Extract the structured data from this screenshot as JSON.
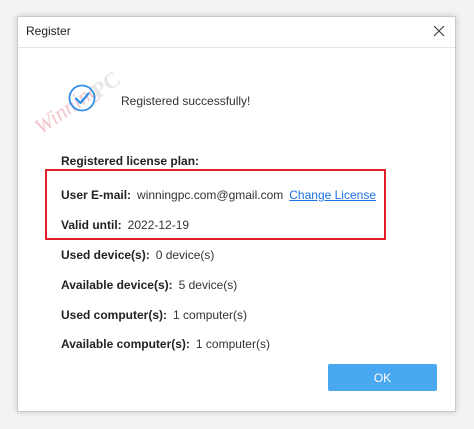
{
  "window": {
    "title": "Register"
  },
  "watermark": {
    "text": "WinningPC"
  },
  "status": {
    "message": "Registered successfully!"
  },
  "license": {
    "heading": "Registered license plan:",
    "email_label": "User E-mail:",
    "email_value": "winningpc.com@gmail.com",
    "change_link": "Change License",
    "valid_label": "Valid until:",
    "valid_value": "2022-12-19",
    "used_devices_label": "Used device(s):",
    "used_devices_value": "0 device(s)",
    "available_devices_label": "Available device(s):",
    "available_devices_value": "5 device(s)",
    "used_computers_label": "Used computer(s):",
    "used_computers_value": "1 computer(s)",
    "available_computers_label": "Available computer(s):",
    "available_computers_value": "1 computer(s)"
  },
  "buttons": {
    "ok": "OK"
  },
  "colors": {
    "accent": "#4aa8f0",
    "link": "#1a73e8",
    "highlight": "#e11e2b"
  },
  "icons": {
    "success": "check-circle-icon",
    "close": "close-icon"
  }
}
